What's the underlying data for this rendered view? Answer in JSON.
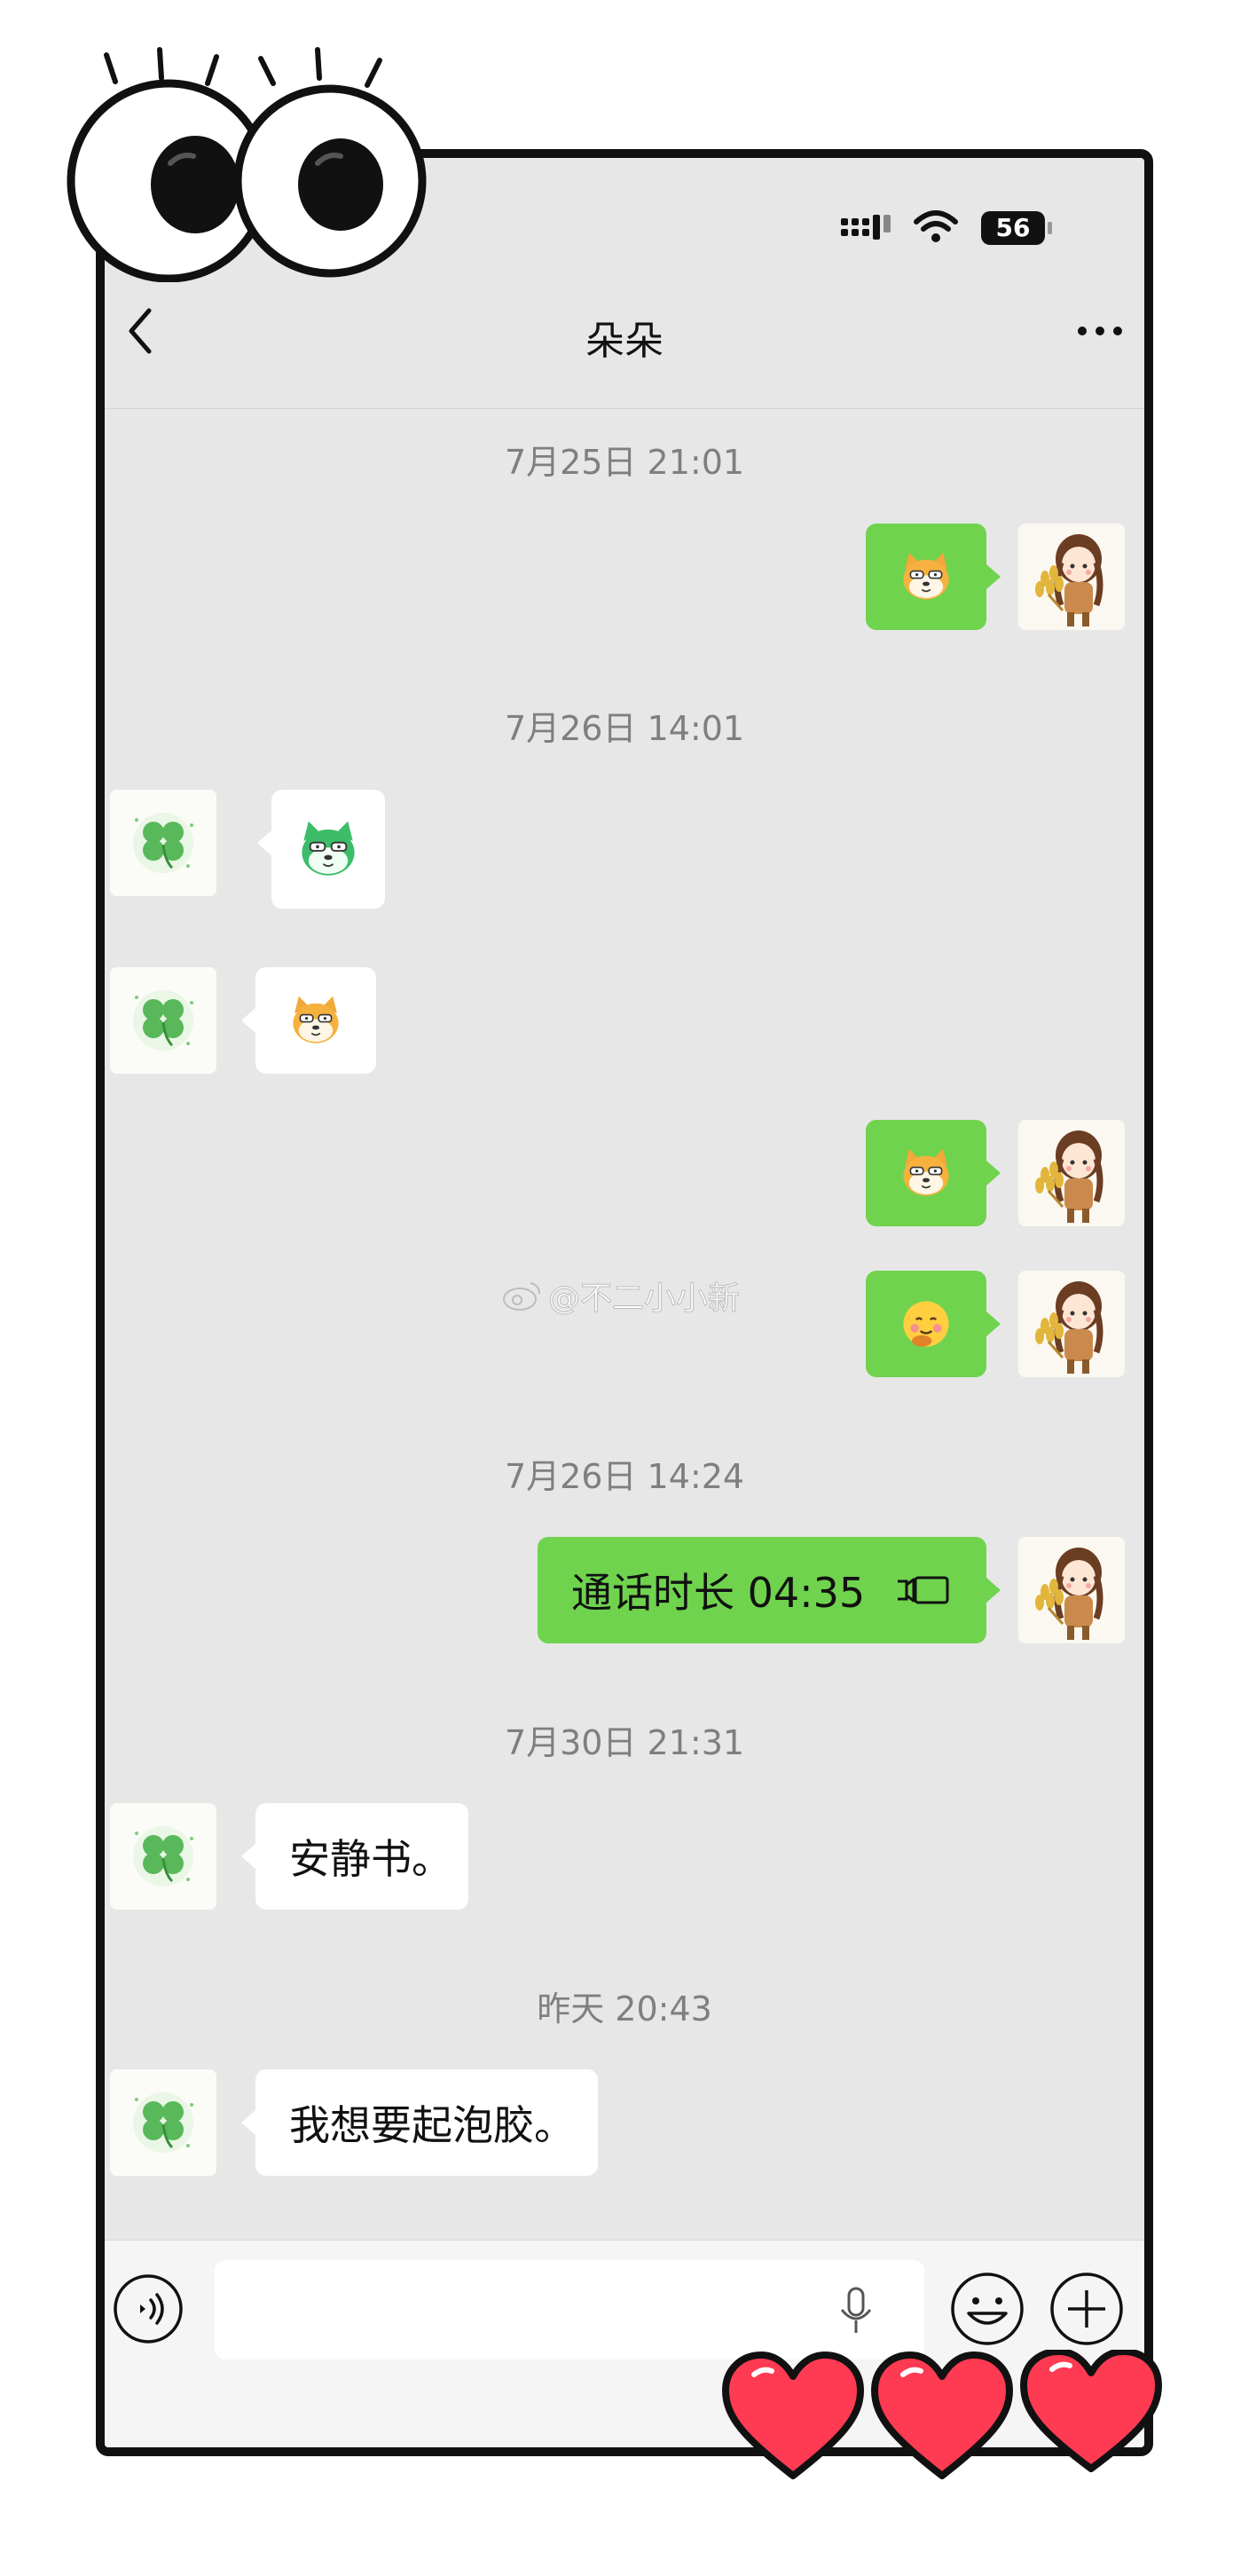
{
  "status_bar": {
    "battery": "56"
  },
  "header": {
    "title": "朵朵"
  },
  "messages": {
    "ts1": "7月25日 21:01",
    "ts2": "7月26日 14:01",
    "ts3": "7月26日 14:24",
    "ts4": "7月30日 21:31",
    "ts5": "昨天 20:43",
    "call_text": "通话时长 04:35",
    "msg1": "安静书。",
    "msg2": "我想要起泡胶。"
  },
  "watermark": {
    "text": "@不二小小新"
  },
  "input": {
    "placeholder": ""
  },
  "colors": {
    "frame_bg": "#e7e7e7",
    "sent_bubble": "#6fd34e",
    "received_bubble": "#ffffff",
    "heart": "#ff3a53"
  },
  "icons": [
    "back-icon",
    "more-icon",
    "signal-icon",
    "wifi-icon",
    "battery-icon",
    "voice-icon",
    "mic-icon",
    "emoji-icon",
    "plus-icon",
    "call-icon",
    "weibo-icon"
  ]
}
